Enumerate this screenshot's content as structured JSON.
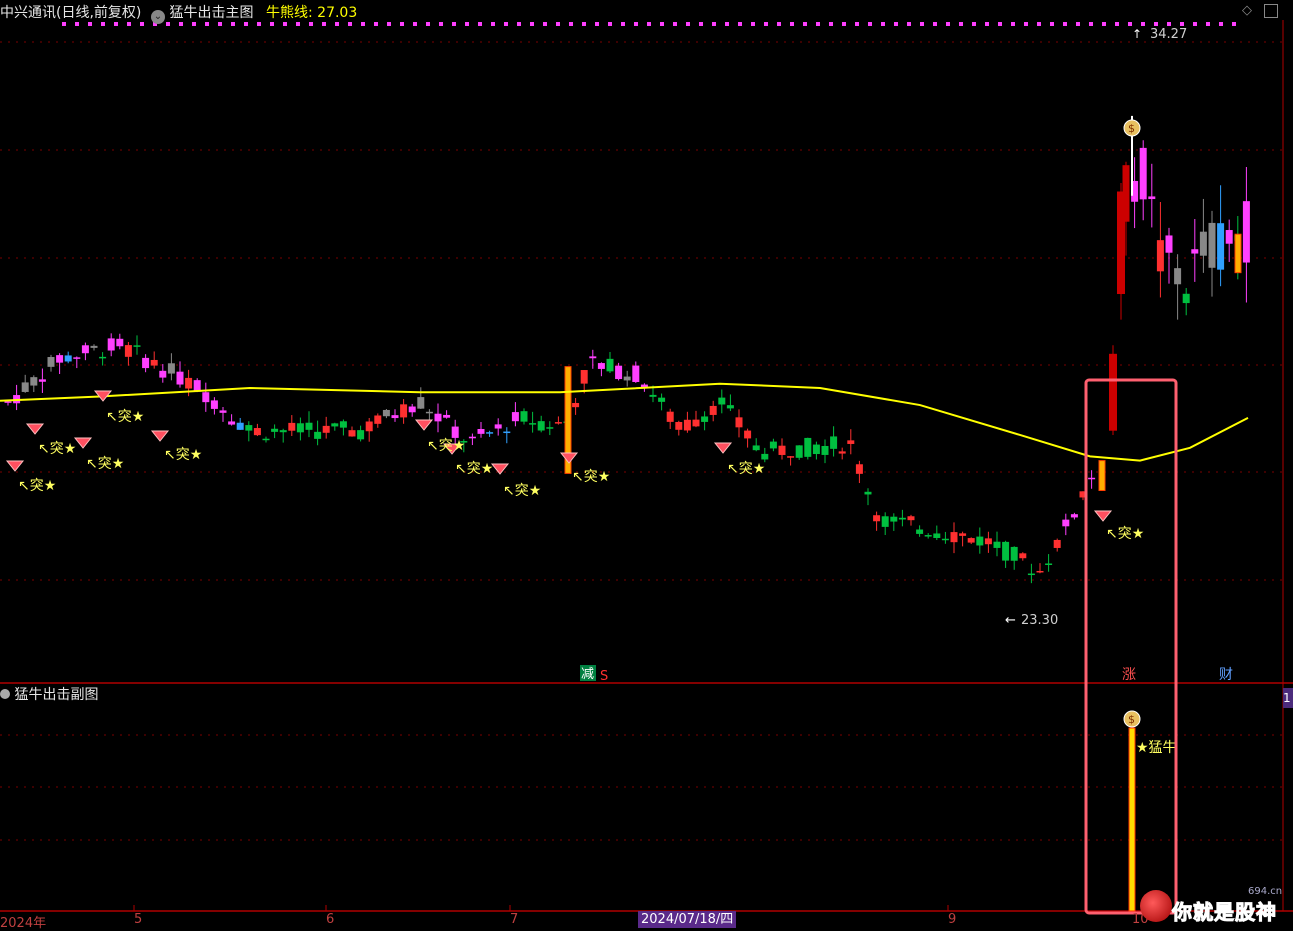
{
  "header": {
    "stock": "中兴通讯(日线,前复权)",
    "indicator": "猛牛出击主图",
    "bullbear_label": "牛熊线:",
    "bullbear_value": "27.03"
  },
  "sub_title": "猛牛出击副图",
  "x_labels": [
    "2024年",
    "5",
    "6",
    "7",
    "9",
    "10"
  ],
  "date_cursor": "2024/07/18/四",
  "annotations": {
    "high_price": "34.27",
    "low_price": "23.30",
    "tu_star": "↖突★",
    "jian": "减",
    "s": "S",
    "zhang": "涨",
    "cai": "财",
    "mengniu": "★猛牛",
    "right_badge": "1"
  },
  "watermark": {
    "text": "你就是股神",
    "domain": "694.cn"
  },
  "colors": {
    "up": "#ff3030",
    "down": "#00c040",
    "magenta": "#ff40ff",
    "yellow_line": "#ffff00",
    "grid": "#7a0000",
    "highlight": "#ff6070"
  },
  "chart_data": {
    "type": "candlestick",
    "y_range": [
      22,
      36
    ],
    "sub_y_range": [
      0,
      1
    ],
    "price_marks": {
      "high": 34.27,
      "low": 23.3
    },
    "ma_line": [
      [
        0,
        27.6
      ],
      [
        100,
        27.7
      ],
      [
        250,
        27.9
      ],
      [
        420,
        27.8
      ],
      [
        560,
        27.8
      ],
      [
        720,
        28.0
      ],
      [
        820,
        27.9
      ],
      [
        920,
        27.5
      ],
      [
        1020,
        26.8
      ],
      [
        1090,
        26.3
      ],
      [
        1140,
        26.2
      ],
      [
        1190,
        26.5
      ],
      [
        1248,
        27.2
      ]
    ]
  }
}
